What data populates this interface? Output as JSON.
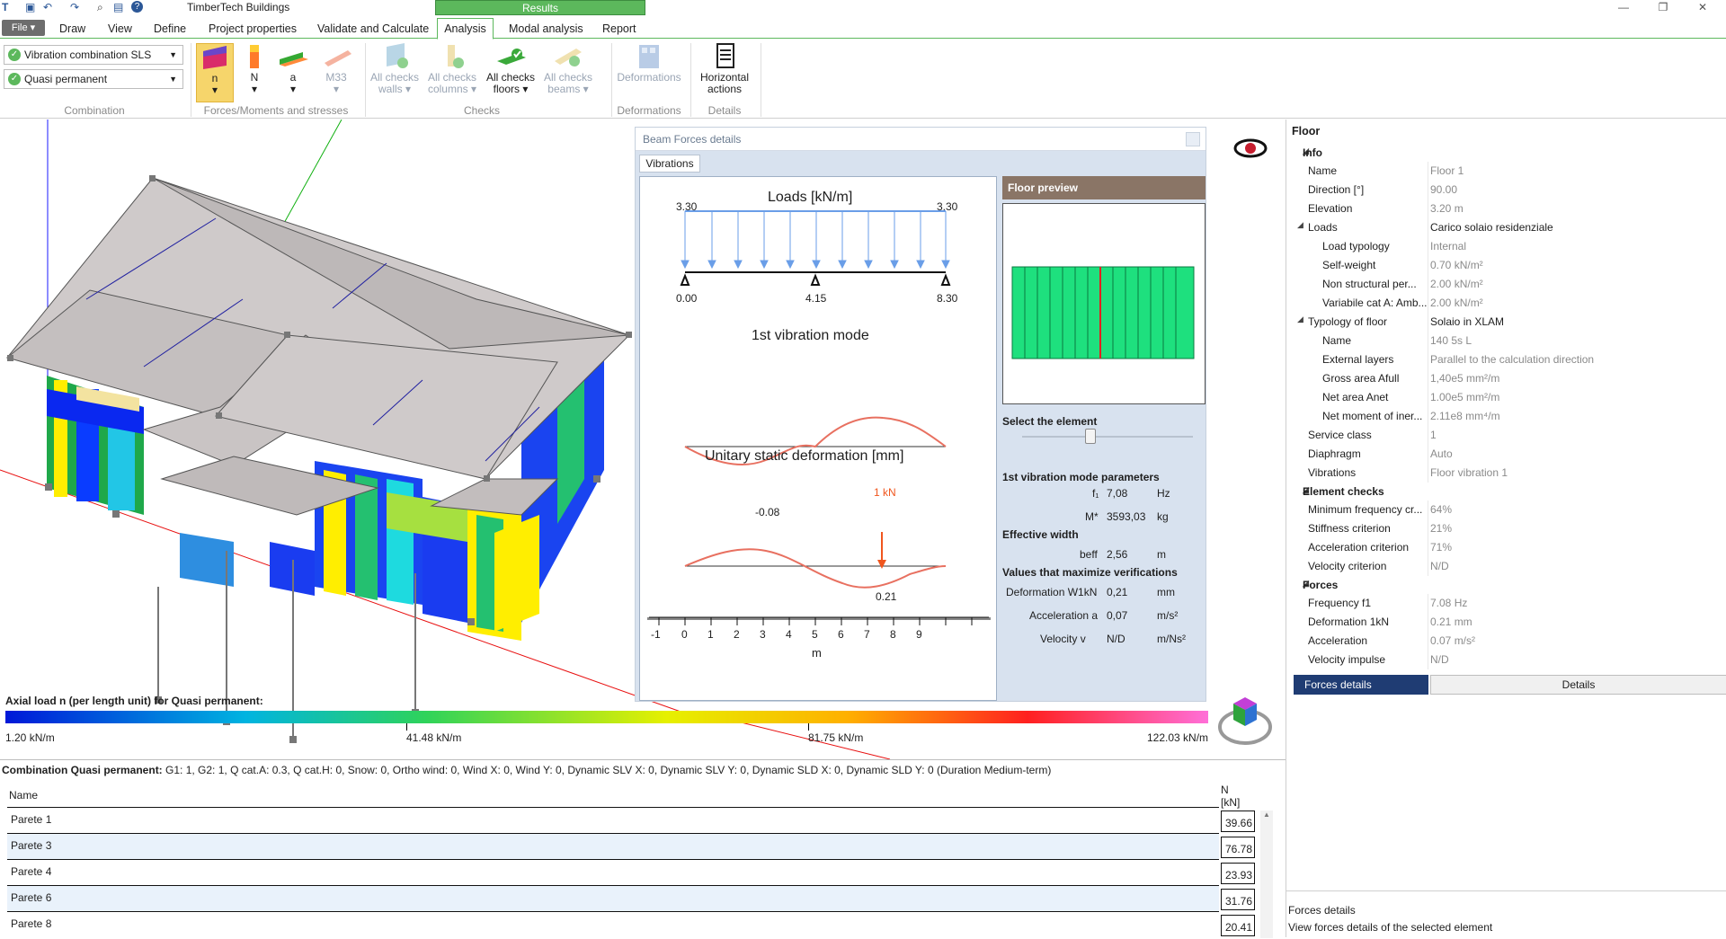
{
  "app": {
    "title": "TimberTech Buildings",
    "results_tab": "Results"
  },
  "menu": {
    "file": "File",
    "items": [
      "Draw",
      "View",
      "Define",
      "Project properties",
      "Validate and Calculate",
      "Analysis",
      "Modal analysis",
      "Report"
    ]
  },
  "ribbon": {
    "combination": {
      "combo1": "Vibration combination SLS",
      "combo2": "Quasi permanent",
      "group_label": "Combination"
    },
    "forces": {
      "buttons": [
        "n",
        "N",
        "a",
        "M33"
      ],
      "group_label": "Forces/Moments and stresses"
    },
    "checks": {
      "buttons": [
        [
          "All checks",
          "walls"
        ],
        [
          "All checks",
          "columns"
        ],
        [
          "All checks",
          "floors"
        ],
        [
          "All checks",
          "beams"
        ]
      ],
      "group_label": "Checks"
    },
    "deformations": {
      "button": "Deformations",
      "group_label": "Deformations"
    },
    "details": {
      "button": [
        "Horizontal",
        "actions"
      ],
      "group_label": "Details"
    }
  },
  "legend": {
    "title": "Axial load n (per length unit) for Quasi permanent:",
    "labels": [
      "1.20 kN/m",
      "41.48 kN/m",
      "81.75 kN/m",
      "122.03 kN/m"
    ]
  },
  "forces_panel": {
    "title": "Beam Forces details",
    "tab": "Vibrations",
    "chart_titles": {
      "loads": "Loads [kN/m]",
      "mode": "1st vibration mode",
      "deform": "Unitary static deformation [mm]"
    },
    "load_values": [
      "3.30",
      "3.30"
    ],
    "span_labels": [
      "0.00",
      "4.15",
      "8.30"
    ],
    "deform_labels": {
      "neg": "-0.08",
      "pos": "0.21",
      "point_load": "1 kN"
    },
    "axis_ticks": [
      "-1",
      "0",
      "1",
      "2",
      "3",
      "4",
      "5",
      "6",
      "7",
      "8",
      "9"
    ],
    "axis_unit": "m",
    "preview_head": "Floor preview",
    "select_label": "Select the element",
    "params_title": "1st vibration mode parameters",
    "f1": {
      "label": "f₁",
      "value": "7,08",
      "unit": "Hz"
    },
    "mstar": {
      "label": "M*",
      "value": "3593,03",
      "unit": "kg"
    },
    "eff_title": "Effective width",
    "beff": {
      "label": "beff",
      "value": "2,56",
      "unit": "m"
    },
    "max_title": "Values that maximize verifications",
    "w1kn": {
      "label": "Deformation W1kN",
      "value": "0,21",
      "unit": "mm"
    },
    "acc": {
      "label": "Acceleration a",
      "value": "0,07",
      "unit": "m/s²"
    },
    "vel": {
      "label": "Velocity v",
      "value": "N/D",
      "unit": "m/Ns²"
    }
  },
  "properties": {
    "title": "Floor",
    "info": {
      "section": "Info",
      "name": [
        "Name",
        "Floor 1"
      ],
      "direction": [
        "Direction [°]",
        "90.00"
      ],
      "elevation": [
        "Elevation",
        "3.20 m"
      ],
      "loads": [
        "Loads",
        "Carico solaio residenziale"
      ],
      "load_typology": [
        "Load typology",
        "Internal"
      ],
      "self_weight": [
        "Self-weight",
        "0.70 kN/m²"
      ],
      "non_structural": [
        "Non structural per...",
        "2.00 kN/m²"
      ],
      "variable": [
        "Variabile cat A: Amb...",
        "2.00 kN/m²"
      ],
      "typology": [
        "Typology of floor",
        "Solaio in XLAM"
      ],
      "typ_name": [
        "Name",
        "140 5s L"
      ],
      "external_layers": [
        "External layers",
        "Parallel to the calculation direction"
      ],
      "gross_area": [
        "Gross area Afull",
        "1,40e5 mm²/m"
      ],
      "net_area": [
        "Net area Anet",
        "1.00e5 mm²/m"
      ],
      "net_moment": [
        "Net moment of iner...",
        "2.11e8 mm⁴/m"
      ],
      "service_class": [
        "Service class",
        "1"
      ],
      "diaphragm": [
        "Diaphragm",
        "Auto"
      ],
      "vibrations": [
        "Vibrations",
        "Floor vibration 1"
      ]
    },
    "element_checks": {
      "section": "Element checks",
      "rows": [
        [
          "Minimum frequency cr...",
          "64%"
        ],
        [
          "Stiffness criterion",
          "21%"
        ],
        [
          "Acceleration criterion",
          "71%"
        ],
        [
          "Velocity criterion",
          "N/D"
        ]
      ]
    },
    "forces": {
      "section": "Forces",
      "rows": [
        [
          "Frequency f1",
          "7.08 Hz"
        ],
        [
          "Deformation 1kN",
          "0.21 mm"
        ],
        [
          "Acceleration",
          "0.07 m/s²"
        ],
        [
          "Velocity impulse",
          "N/D"
        ]
      ]
    },
    "forces_details_btn": "Forces details",
    "details_btn": "Details",
    "desc_title": "Forces details",
    "desc": "View forces details of the selected element"
  },
  "bottom": {
    "combo_label": "Combination Quasi permanent:",
    "combo_text": "G1: 1, G2: 1, Q cat.A: 0.3, Q cat.H: 0, Snow: 0, Ortho wind: 0, Wind X: 0, Wind Y: 0, Dynamic SLV X: 0, Dynamic SLV Y: 0, Dynamic SLD X: 0, Dynamic SLD Y: 0 (Duration Medium-term)",
    "col_name": "Name",
    "col_n": "N",
    "col_n_unit": "[kN]",
    "rows": [
      [
        "Parete 1",
        "39.66"
      ],
      [
        "Parete 3",
        "76.78"
      ],
      [
        "Parete 4",
        "23.93"
      ],
      [
        "Parete 6",
        "31.76"
      ],
      [
        "Parete 8",
        "20.41"
      ]
    ]
  }
}
